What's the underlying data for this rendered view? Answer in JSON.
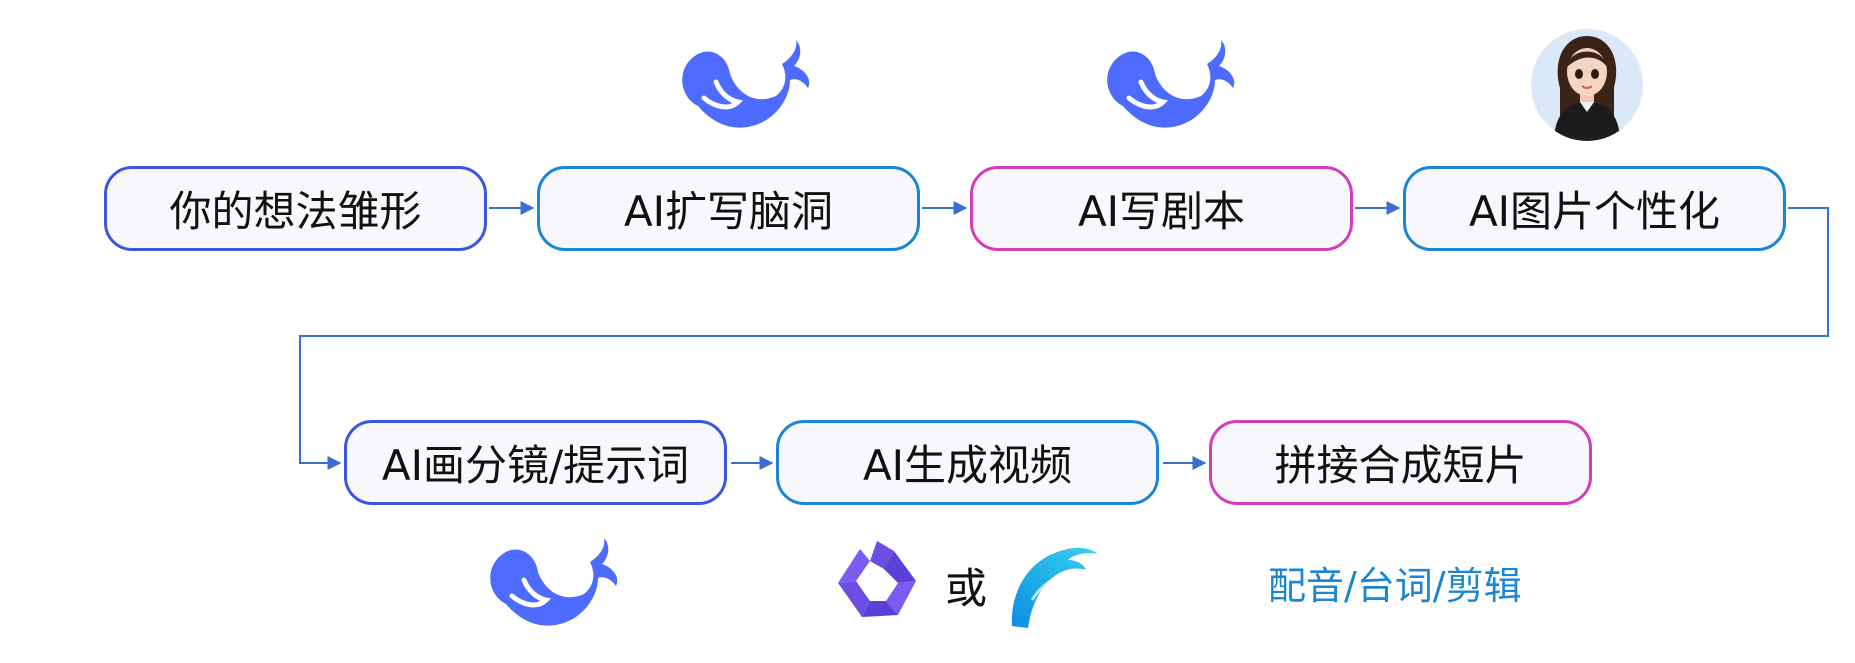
{
  "steps_row1": [
    {
      "label": "你的想法雏形",
      "color": "#3a57e0"
    },
    {
      "label": "AI扩写脑洞",
      "color": "#1a86d4"
    },
    {
      "label": "AI写剧本",
      "color": "#d43cbf"
    },
    {
      "label": "AI图片个性化",
      "color": "#1a86d4"
    }
  ],
  "steps_row2": [
    {
      "label": "AI画分镜/提示词",
      "color": "#3a57e0"
    },
    {
      "label": "AI生成视频",
      "color": "#1a86d4"
    },
    {
      "label": "拼接合成短片",
      "color": "#d43cbf"
    }
  ],
  "or_label": "或",
  "post_note": "配音/台词/剪辑",
  "colors": {
    "connector": "#3a6fd0",
    "whale": "#4d6bfe",
    "note": "#1a86d4"
  },
  "icons": [
    "deepseek-whale-icon",
    "avatar-icon",
    "qwen-logo-icon",
    "dolphin-logo-icon"
  ]
}
